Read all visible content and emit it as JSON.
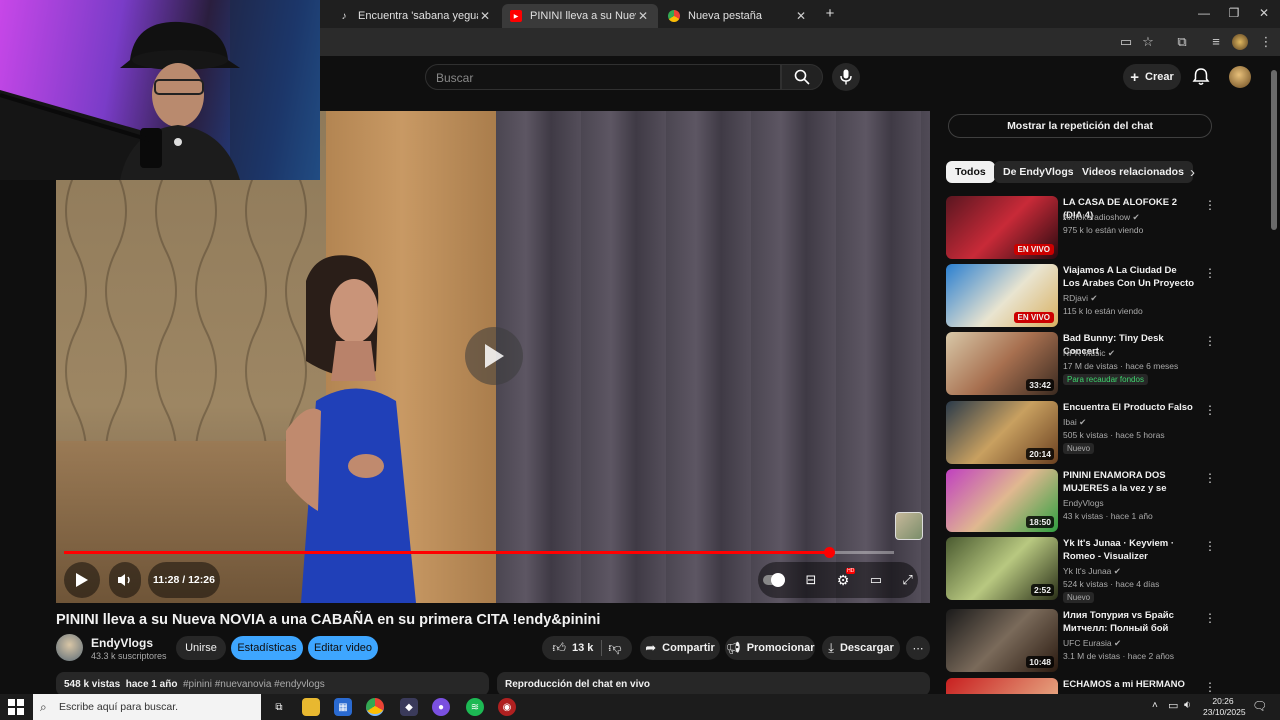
{
  "browser": {
    "tabs": [
      {
        "label": "Encuentra 'sabana yegua azua",
        "icon": "tiktok-icon"
      },
      {
        "label": "PININI lleva a su Nueva NOVIA",
        "icon": "youtube-icon"
      },
      {
        "label": "Nueva pestaña",
        "icon": "chrome-icon"
      }
    ],
    "new_tab": "+"
  },
  "youtube": {
    "search_placeholder": "Buscar",
    "create_label": "Crear"
  },
  "video": {
    "time_current": "11:28",
    "time_total": "12:26",
    "progress": 0.922,
    "title": "PININI lleva a su Nueva NOVIA a una CABAÑA en su primera CITA !endy&pinini",
    "channel_name": "EndyVlogs",
    "channel_subs": "43.3 k suscriptores",
    "join_label": "Unirse",
    "stats_label": "Estadísticas",
    "edit_label": "Editar video",
    "likes": "13 k",
    "share_label": "Compartir",
    "promote_label": "Promocionar",
    "download_label": "Descargar",
    "views": "548 k vistas",
    "age": "hace 1 año",
    "hashtags": "#pinini #nuevanovia #endyvlogs",
    "chat_replay_title": "Reproducción del chat en vivo"
  },
  "sidebar": {
    "show_chat": "Mostrar la repetición del chat",
    "chips": [
      "Todos",
      "De EndyVlogs",
      "Videos relacionados"
    ],
    "items": [
      {
        "title": "LA CASA DE ALOFOKE 2 (DIA 4)",
        "channel": "Alofokeradioshow",
        "meta": "975 k lo están viendo",
        "badge": "",
        "overlay": "EN VIVO"
      },
      {
        "title": "Viajamos A La Ciudad De Los Arabes Con Un Proyecto De ...",
        "channel": "RDjavi",
        "meta": "115 k lo están viendo",
        "badge": "",
        "overlay": "EN VIVO"
      },
      {
        "title": "Bad Bunny: Tiny Desk Concert",
        "channel": "NPR Music",
        "meta": "17 M de vistas · hace 6 meses",
        "badge": "Para recaudar fondos",
        "overlay": "33:42"
      },
      {
        "title": "Encuentra El Producto Falso",
        "channel": "Ibai",
        "meta": "505 k vistas · hace 5 horas",
        "badge": "Nuevo",
        "overlay": "20:14"
      },
      {
        "title": "PININI ENAMORA DOS MUJERES a la vez y se busca ...",
        "channel": "EndyVlogs",
        "meta": "43 k vistas · hace 1 año",
        "badge": "",
        "overlay": "18:50"
      },
      {
        "title": "Yk It's Junaa · Keyviem · Romeo - Visualizer",
        "channel": "Yk It's Junaa",
        "meta": "524 k vistas · hace 4 días",
        "badge": "Nuevo",
        "overlay": "2:52"
      },
      {
        "title": "Илия Топурия vs Брайс Митчелл: Полный бой",
        "channel": "UFC Eurasia",
        "meta": "3.1 M de vistas · hace 2 años",
        "badge": "",
        "overlay": "10:48"
      },
      {
        "title": "ECHAMOS a mi HERMANO",
        "channel": "",
        "meta": "",
        "badge": "",
        "overlay": ""
      }
    ]
  },
  "taskbar": {
    "search_placeholder": "Escribe aquí para buscar.",
    "time": "20:26",
    "date": "23/10/2025"
  },
  "colors": {
    "accent_red": "#ff0000",
    "accent_blue": "#3ea6ff",
    "background": "#0f0f0f"
  }
}
